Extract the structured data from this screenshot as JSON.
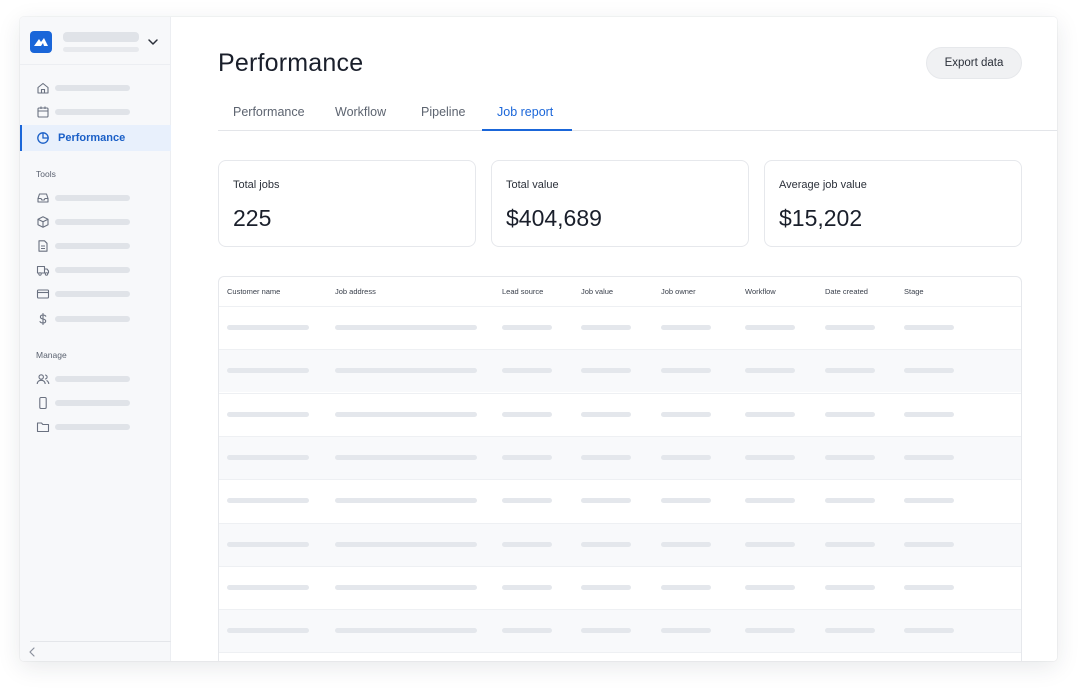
{
  "sidebar": {
    "sections": [
      {
        "label": ""
      },
      {
        "label": "Tools"
      },
      {
        "label": "Manage"
      }
    ],
    "active_item": {
      "label": "Performance",
      "icon": "pie-chart-icon"
    },
    "icons": {
      "top": [
        "home-icon",
        "calendar-icon"
      ],
      "tools": [
        "inbox-icon",
        "box-icon",
        "document-icon",
        "truck-icon",
        "credit-card-icon",
        "dollar-icon"
      ],
      "manage": [
        "users-icon",
        "phone-icon",
        "folder-icon"
      ]
    }
  },
  "header": {
    "title": "Performance",
    "export_label": "Export data"
  },
  "tabs": [
    {
      "label": "Performance",
      "active": false
    },
    {
      "label": "Workflow",
      "active": false
    },
    {
      "label": "Pipeline",
      "active": false
    },
    {
      "label": "Job report",
      "active": true
    }
  ],
  "stats": [
    {
      "label": "Total jobs",
      "value": "225"
    },
    {
      "label": "Total value",
      "value": "$404,689"
    },
    {
      "label": "Average job value",
      "value": "$15,202"
    }
  ],
  "table": {
    "columns": [
      "Customer name",
      "Job address",
      "Lead source",
      "Job value",
      "Job owner",
      "Workflow",
      "Date created",
      "Stage"
    ]
  },
  "colors": {
    "accent": "#1a66d9",
    "active_bg": "#e8f0fc"
  }
}
